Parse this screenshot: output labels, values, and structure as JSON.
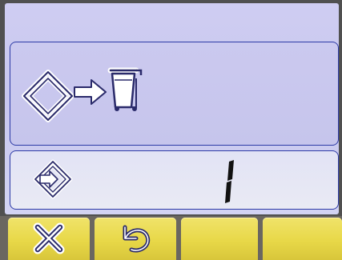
{
  "display": {
    "delete_panel": {
      "icons": [
        "memory-location-icon",
        "arrow-right-icon",
        "trash-bin-icon"
      ]
    },
    "status_panel": {
      "icon": "memory-location-icon",
      "counter_value": "1"
    }
  },
  "softkeys": [
    {
      "name": "softkey-cancel",
      "icon": "close-x-icon"
    },
    {
      "name": "softkey-undo",
      "icon": "undo-arrow-icon"
    },
    {
      "name": "softkey-3",
      "icon": ""
    },
    {
      "name": "softkey-4",
      "icon": ""
    }
  ],
  "colors": {
    "lcd_background": "#cbc9ef",
    "panel_border": "#2c3aa6",
    "softkey_yellow": "#e8d848",
    "icon_stroke": "#2a2a6a"
  }
}
